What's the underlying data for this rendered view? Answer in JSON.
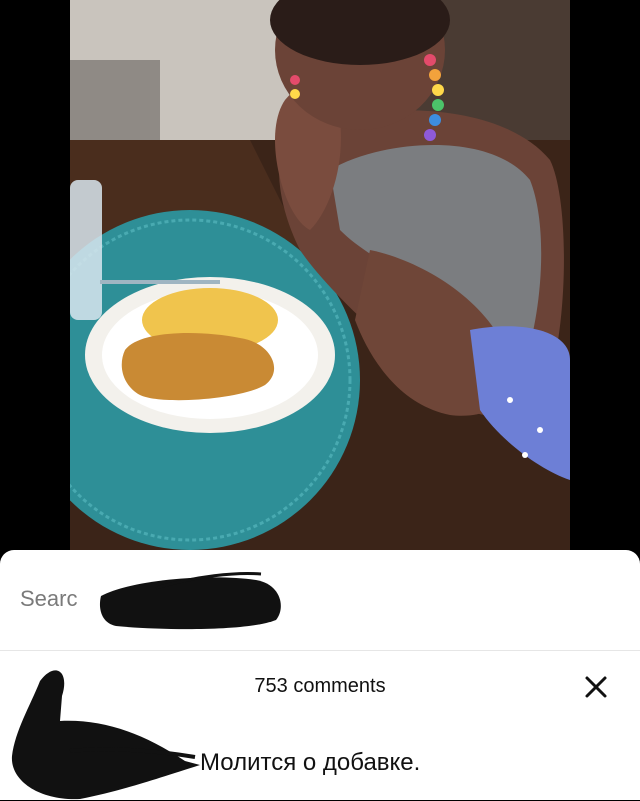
{
  "search": {
    "label": "Searc"
  },
  "comments": {
    "count_label": "753 comments",
    "close_icon": "close-icon"
  },
  "post": {
    "caption": "Молится о добавке."
  }
}
